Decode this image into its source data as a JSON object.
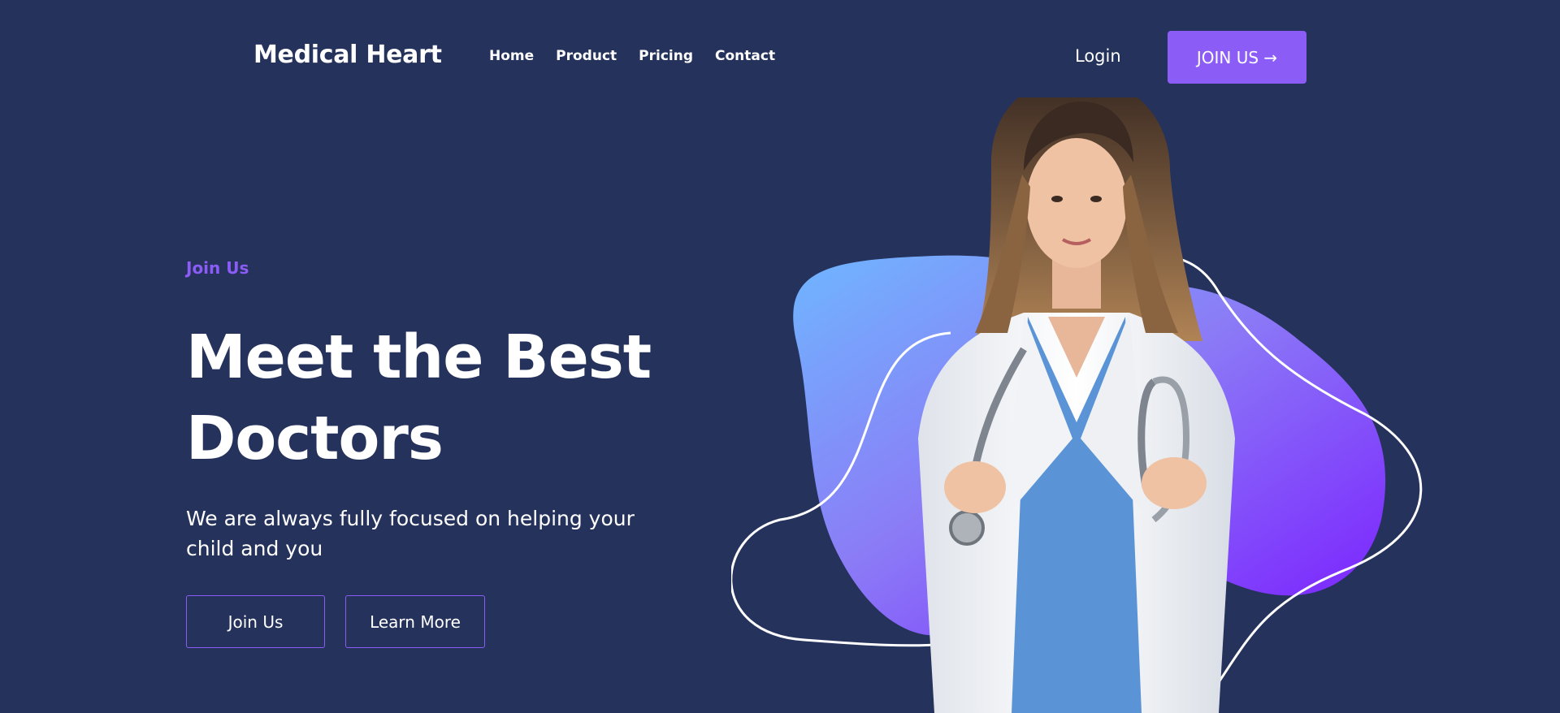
{
  "header": {
    "brand": "Medical Heart",
    "nav": [
      "Home",
      "Product",
      "Pricing",
      "Contact"
    ],
    "login_label": "Login",
    "join_label": "JOIN US →"
  },
  "hero": {
    "eyebrow": "Join Us",
    "headline_line1": "Meet the Best",
    "headline_line2": "Doctors",
    "subtext": "We are always fully focused on helping your child and you",
    "primary_button": "Join Us",
    "secondary_button": "Learn More"
  },
  "colors": {
    "background": "#25325c",
    "accent": "#8b5cf6",
    "blob_start": "#6fb6ff",
    "blob_end": "#7a1cff"
  },
  "illustration": {
    "subject": "doctor-photo",
    "icons": [
      "stethoscope-icon"
    ]
  }
}
